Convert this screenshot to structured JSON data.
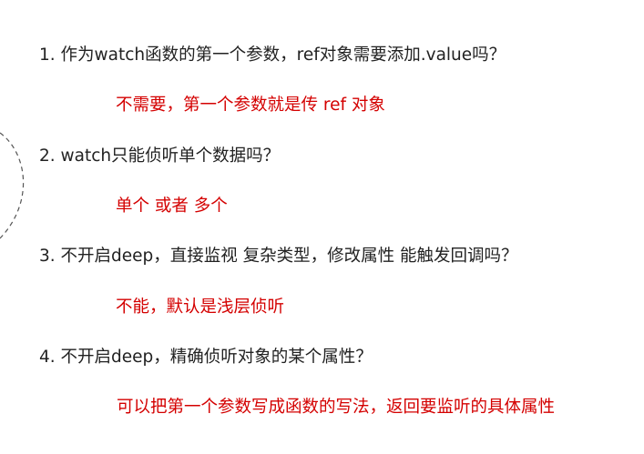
{
  "items": [
    {
      "question": "1. 作为watch函数的第一个参数，ref对象需要添加.value吗？",
      "answer": "不需要，第一个参数就是传 ref 对象"
    },
    {
      "question": "2.  watch只能侦听单个数据吗？",
      "answer": "单个 或者 多个"
    },
    {
      "question": "3.  不开启deep，直接监视 复杂类型，修改属性 能触发回调吗？",
      "answer": "不能，默认是浅层侦听"
    },
    {
      "question": "4.  不开启deep，精确侦听对象的某个属性？",
      "answer": "可以把第一个参数写成函数的写法，返回要监听的具体属性"
    }
  ],
  "colors": {
    "question_text": "#222222",
    "answer_text": "#d40000",
    "decoration_stroke": "#555555"
  }
}
